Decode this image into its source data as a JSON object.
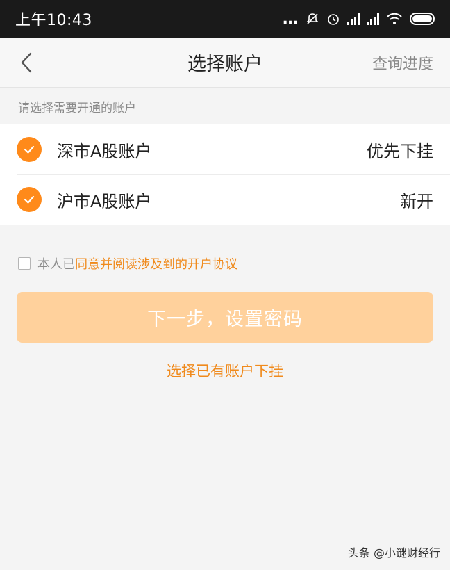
{
  "status_bar": {
    "time": "上午10:43",
    "icons": [
      "more-dots-icon",
      "mute-icon",
      "alarm-icon",
      "signal-icon",
      "signal-icon",
      "wifi-icon",
      "battery-icon"
    ]
  },
  "nav": {
    "title": "选择账户",
    "right_label": "查询进度",
    "back_icon": "chevron-left-icon"
  },
  "hint": "请选择需要开通的账户",
  "accounts": [
    {
      "name": "深市A股账户",
      "status": "优先下挂",
      "checked": true
    },
    {
      "name": "沪市A股账户",
      "status": "新开",
      "checked": true
    }
  ],
  "agreement": {
    "prefix": "本人已",
    "link": "同意并阅读涉及到的开户协议",
    "checked": false
  },
  "next_button": "下一步，设置密码",
  "existing_link": "选择已有账户下挂",
  "watermark": "头条 @小谜财经行",
  "colors": {
    "accent": "#ff8a1a",
    "link": "#f08a1c",
    "button_disabled": "#ffd19c",
    "background": "#f4f4f4"
  }
}
